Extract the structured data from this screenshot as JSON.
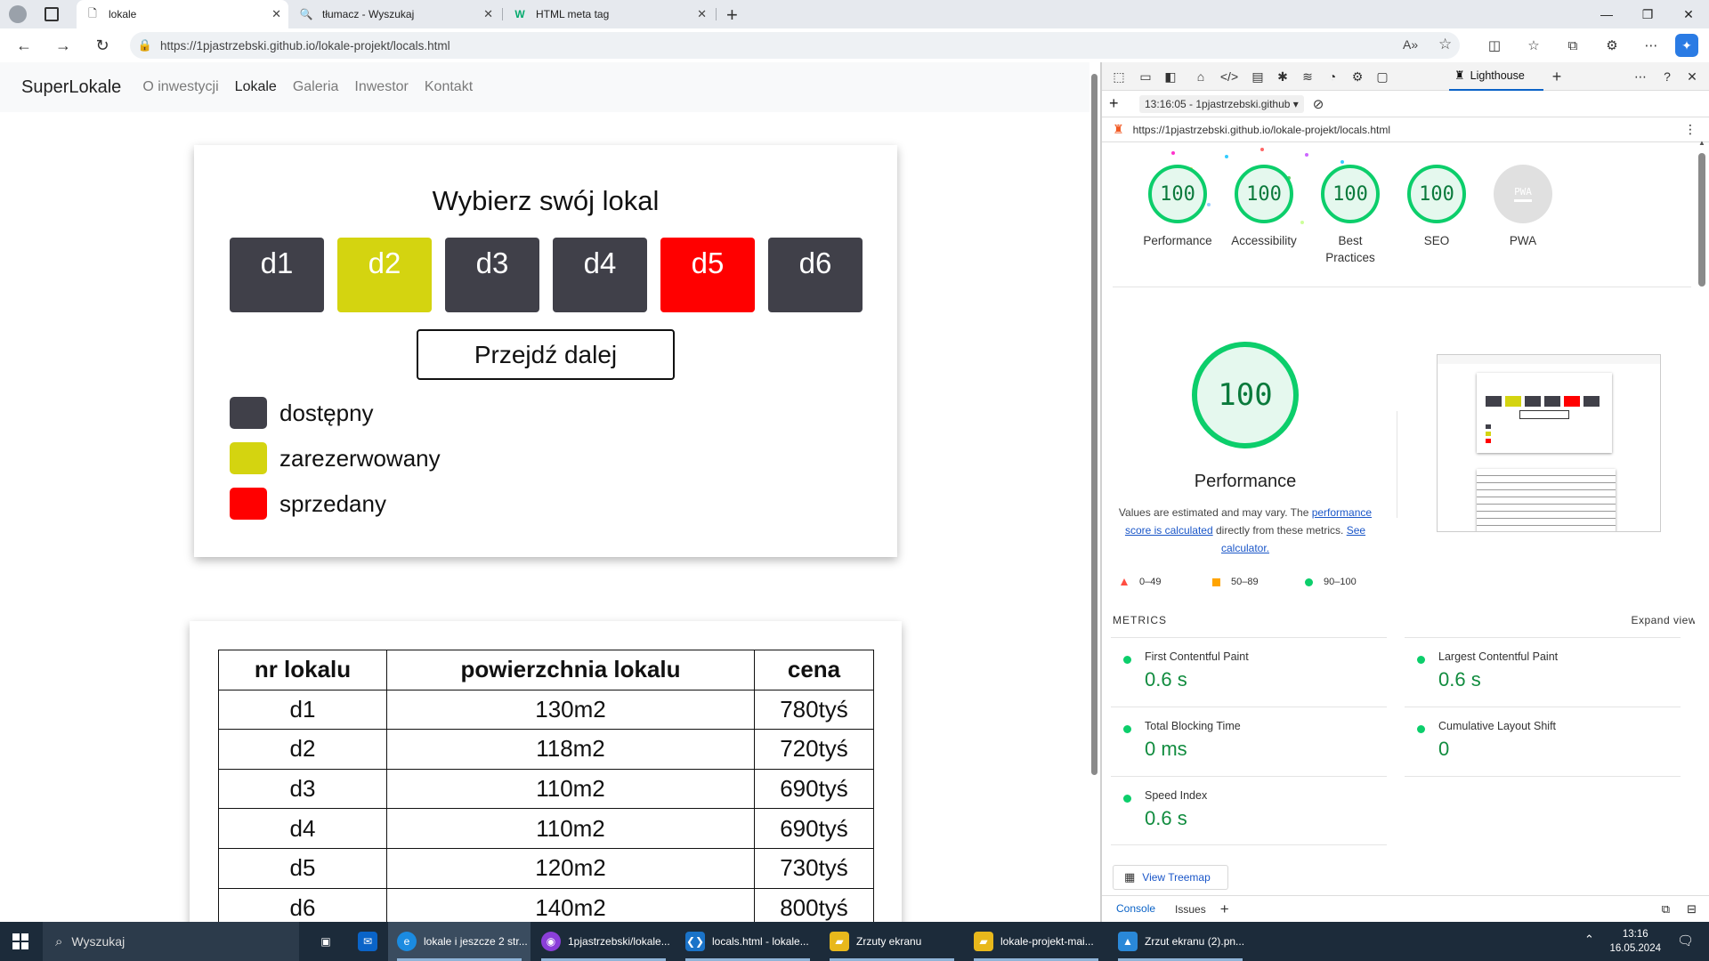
{
  "browser": {
    "tabs": [
      {
        "title": "lokale",
        "active": true
      },
      {
        "title": "tłumacz - Wyszukaj",
        "active": false
      },
      {
        "title": "HTML meta tag",
        "active": false
      }
    ],
    "url_domain": "https://1pjastrzebski.github.io",
    "url_path": "/lokale-projekt/locals.html"
  },
  "site": {
    "brand": "SuperLokale",
    "nav": [
      {
        "label": "O inwestycji",
        "active": false
      },
      {
        "label": "Lokale",
        "active": true
      },
      {
        "label": "Galeria",
        "active": false
      },
      {
        "label": "Inwestor",
        "active": false
      },
      {
        "label": "Kontakt",
        "active": false
      }
    ],
    "select_title": "Wybierz swój lokal",
    "units": [
      {
        "label": "d1",
        "status": "available"
      },
      {
        "label": "d2",
        "status": "reserved"
      },
      {
        "label": "d3",
        "status": "available"
      },
      {
        "label": "d4",
        "status": "available"
      },
      {
        "label": "d5",
        "status": "sold"
      },
      {
        "label": "d6",
        "status": "available"
      }
    ],
    "next_button": "Przejdź dalej",
    "legend": [
      {
        "label": "dostępny",
        "color": "#404049"
      },
      {
        "label": "zarezerwowany",
        "color": "#d4d410"
      },
      {
        "label": "sprzedany",
        "color": "#ff0000"
      }
    ],
    "table": {
      "headers": [
        "nr lokalu",
        "powierzchnia lokalu",
        "cena"
      ],
      "rows": [
        [
          "d1",
          "130m2",
          "780tyś"
        ],
        [
          "d2",
          "118m2",
          "720tyś"
        ],
        [
          "d3",
          "110m2",
          "690tyś"
        ],
        [
          "d4",
          "110m2",
          "690tyś"
        ],
        [
          "d5",
          "120m2",
          "730tyś"
        ],
        [
          "d6",
          "140m2",
          "800tyś"
        ]
      ]
    }
  },
  "colors": {
    "available": "#404049",
    "reserved": "#d4d410",
    "sold": "#ff0000",
    "pass": "#0cce6b",
    "average": "#ffa400",
    "fail": "#ff4e42"
  },
  "devtools": {
    "active_tab": "Lighthouse",
    "report_time": "13:16:05 - 1pjastrzebski.github",
    "report_url": "https://1pjastrzebski.github.io/lokale-projekt/locals.html",
    "scores": [
      {
        "label": "Performance",
        "value": "100"
      },
      {
        "label": "Accessibility",
        "value": "100"
      },
      {
        "label": "Best Practices",
        "value": "100"
      },
      {
        "label": "SEO",
        "value": "100"
      }
    ],
    "pwa_label": "PWA",
    "pwa_badge": "PWA",
    "big_score": "100",
    "big_label": "Performance",
    "desc_1": "Values are estimated and may vary. The ",
    "desc_link_1": "performance score is calculated",
    "desc_2": " directly from these metrics. ",
    "desc_link_2": "See calculator.",
    "ranges": [
      "0–49",
      "50–89",
      "90–100"
    ],
    "metrics_header": "METRICS",
    "expand_view": "Expand view",
    "metrics": [
      {
        "name": "First Contentful Paint",
        "value": "0.6 s"
      },
      {
        "name": "Largest Contentful Paint",
        "value": "0.6 s"
      },
      {
        "name": "Total Blocking Time",
        "value": "0 ms"
      },
      {
        "name": "Cumulative Layout Shift",
        "value": "0"
      },
      {
        "name": "Speed Index",
        "value": "0.6 s"
      }
    ],
    "view_treemap": "View Treemap",
    "drawer_tabs": [
      "Console",
      "Issues"
    ]
  },
  "taskbar": {
    "search": "Wyszukaj",
    "items": [
      "lokale i jeszcze 2 str...",
      "1pjastrzebski/lokale...",
      "locals.html - lokale...",
      "Zrzuty ekranu",
      "lokale-projekt-mai...",
      "Zrzut ekranu (2).pn..."
    ],
    "time": "13:16",
    "date": "16.05.2024"
  }
}
